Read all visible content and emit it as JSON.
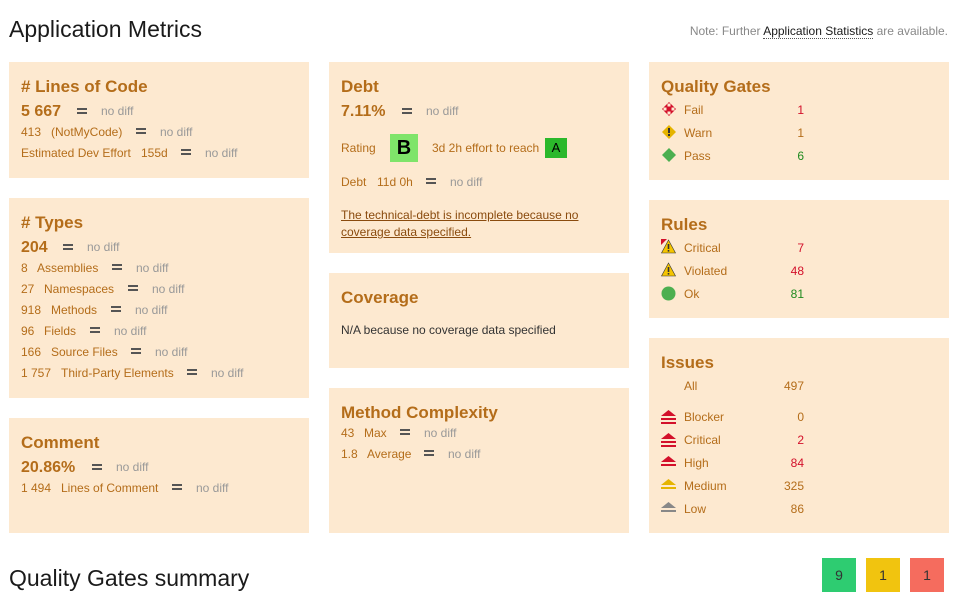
{
  "header": {
    "title": "Application Metrics",
    "note_prefix": "Note: Further",
    "note_link": "Application Statistics",
    "note_suffix": "are available."
  },
  "nodiff": "no diff",
  "loc": {
    "title": "# Lines of Code",
    "value": "5 667",
    "notmycode_value": "413",
    "notmycode_label": "(NotMyCode)",
    "effort_label": "Estimated Dev Effort",
    "effort_value": "155d"
  },
  "types": {
    "title": "# Types",
    "value": "204",
    "rows": [
      {
        "value": "8",
        "label": "Assemblies"
      },
      {
        "value": "27",
        "label": "Namespaces"
      },
      {
        "value": "918",
        "label": "Methods"
      },
      {
        "value": "96",
        "label": "Fields"
      },
      {
        "value": "166",
        "label": "Source Files"
      },
      {
        "value": "1 757",
        "label": "Third-Party Elements"
      }
    ]
  },
  "comment": {
    "title": "Comment",
    "value": "20.86%",
    "lines_value": "1 494",
    "lines_label": "Lines of Comment"
  },
  "debt": {
    "title": "Debt",
    "value": "7.11%",
    "rating_label": "Rating",
    "rating": "B",
    "effort_text": "3d 2h effort to reach",
    "target": "A",
    "debt_label": "Debt",
    "debt_value": "11d 0h",
    "warning": "The technical-debt is incomplete because no coverage data specified."
  },
  "coverage": {
    "title": "Coverage",
    "text": "N/A because no coverage data specified"
  },
  "complexity": {
    "title": "Method Complexity",
    "max_value": "43",
    "max_label": "Max",
    "avg_value": "1.8",
    "avg_label": "Average"
  },
  "quality_gates": {
    "title": "Quality Gates",
    "items": [
      {
        "label": "Fail",
        "count": "1",
        "icon": "fail-diamond-icon",
        "color": "#d3102a"
      },
      {
        "label": "Warn",
        "count": "1",
        "icon": "warning-icon",
        "color": "#e5b400"
      },
      {
        "label": "Pass",
        "count": "6",
        "icon": "pass-diamond-icon",
        "color": "#4caf50"
      }
    ]
  },
  "rules": {
    "title": "Rules",
    "items": [
      {
        "label": "Critical",
        "count": "7",
        "icon": "critical-warning-icon"
      },
      {
        "label": "Violated",
        "count": "48",
        "icon": "warning-icon"
      },
      {
        "label": "Ok",
        "count": "81",
        "icon": "ok-circle-icon"
      }
    ]
  },
  "issues": {
    "title": "Issues",
    "all_label": "All",
    "all_count": "497",
    "items": [
      {
        "label": "Blocker",
        "count": "0",
        "color": "#d3102a"
      },
      {
        "label": "Critical",
        "count": "2",
        "color": "#d3102a"
      },
      {
        "label": "High",
        "count": "84",
        "color": "#d3102a"
      },
      {
        "label": "Medium",
        "count": "325",
        "color": "#e5b400"
      },
      {
        "label": "Low",
        "count": "86",
        "color": "#888888"
      }
    ]
  },
  "summary": {
    "title": "Quality Gates summary",
    "pass": "9",
    "warn": "1",
    "fail": "1",
    "pass_color": "#2ecc71",
    "warn_color": "#f1c40f",
    "fail_color": "#f56c5e"
  }
}
